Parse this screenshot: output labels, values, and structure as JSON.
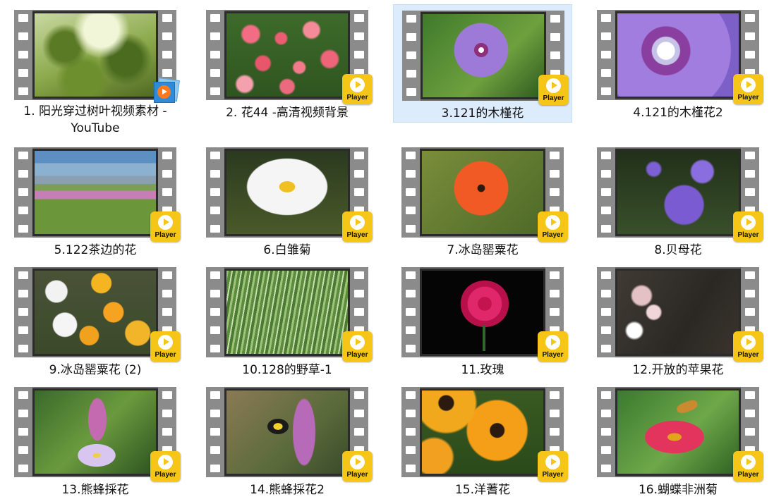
{
  "items": [
    {
      "label": "1. 阳光穿过树叶视频素材 - YouTube",
      "selected": false,
      "badge": "youtube",
      "scene": "leaves"
    },
    {
      "label": "2. 花44 -高清视频背景",
      "selected": false,
      "badge": "player",
      "scene": "roses"
    },
    {
      "label": "3.121的木槿花",
      "selected": true,
      "badge": "player",
      "scene": "hibiscus"
    },
    {
      "label": "4.121的木槿花2",
      "selected": false,
      "badge": "player",
      "scene": "hibiscus2"
    },
    {
      "label": "5.122茶边的花",
      "selected": false,
      "badge": "player",
      "scene": "meadow"
    },
    {
      "label": "6.白雏菊",
      "selected": false,
      "badge": "player",
      "scene": "daisy"
    },
    {
      "label": "7.冰岛罂粟花",
      "selected": false,
      "badge": "player",
      "scene": "poppy"
    },
    {
      "label": "8.贝母花",
      "selected": false,
      "badge": "player",
      "scene": "bellflower"
    },
    {
      "label": "9.冰岛罂粟花 (2)",
      "selected": false,
      "badge": "player",
      "scene": "poppies"
    },
    {
      "label": "10.128的野草-1",
      "selected": false,
      "badge": "player",
      "scene": "grass"
    },
    {
      "label": "11.玫瑰",
      "selected": false,
      "badge": "player",
      "scene": "rose"
    },
    {
      "label": "12.开放的苹果花",
      "selected": false,
      "badge": "player",
      "scene": "apple"
    },
    {
      "label": "13.熊蜂採花",
      "selected": false,
      "badge": "player",
      "scene": "bee1"
    },
    {
      "label": "14.熊蜂採花2",
      "selected": false,
      "badge": "player",
      "scene": "bee2"
    },
    {
      "label": "15.洋蓍花",
      "selected": false,
      "badge": "player",
      "scene": "rudbeckia"
    },
    {
      "label": "16.蝴蝶非洲菊",
      "selected": false,
      "badge": "player",
      "scene": "zinnia"
    }
  ],
  "badges": {
    "player_text": "Player",
    "player_color": "#f5c518"
  },
  "colors": {
    "selection_background": "#dcecfc",
    "selection_border": "#c6def6",
    "film_strip": "#8b8b8b"
  }
}
